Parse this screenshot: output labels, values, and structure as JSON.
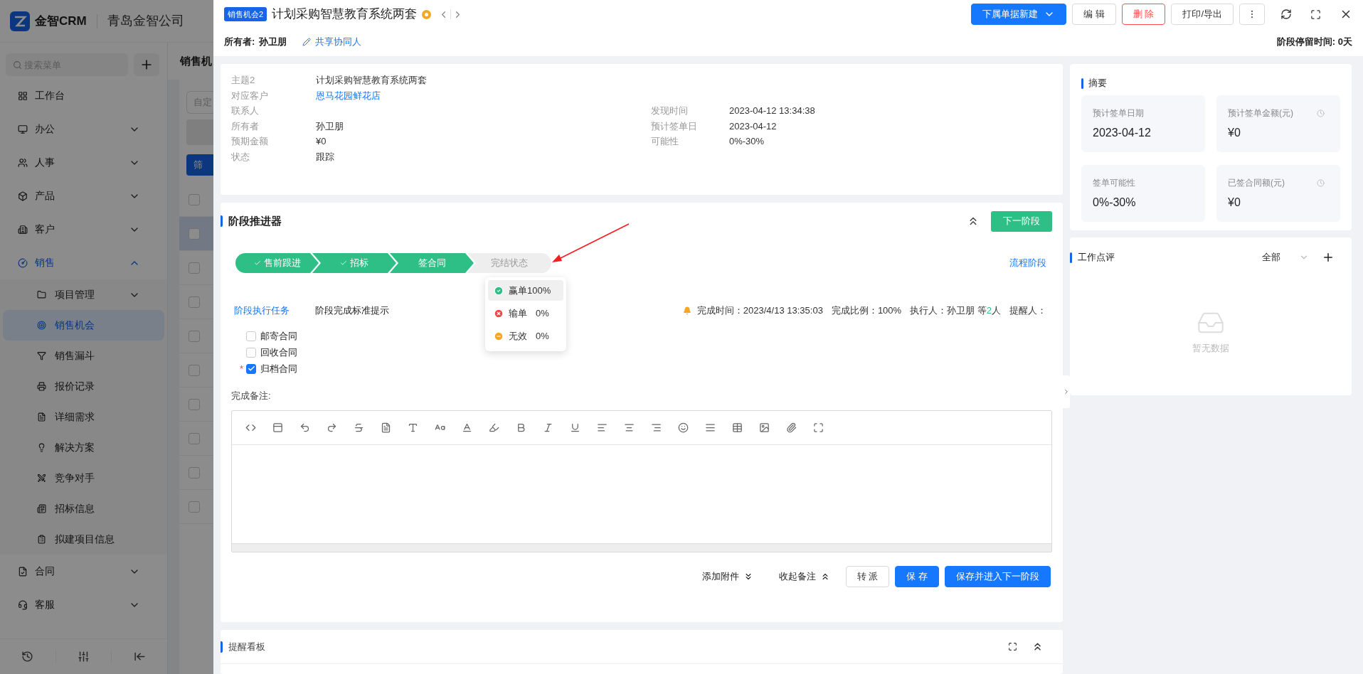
{
  "sidebar": {
    "brand": "金智CRM",
    "company": "青岛金智公司",
    "search": {
      "placeholder": "搜索菜单"
    },
    "items": [
      {
        "label": "工作台",
        "selected": false
      },
      {
        "label": "办公",
        "selected": false,
        "expanded": false
      },
      {
        "label": "人事",
        "selected": false,
        "expanded": false
      },
      {
        "label": "产品",
        "selected": false,
        "expanded": false
      },
      {
        "label": "客户",
        "selected": false,
        "expanded": false
      },
      {
        "label": "销售",
        "selected": true,
        "expanded": true,
        "children": [
          {
            "label": "项目管理",
            "selected": false,
            "expanded": false
          },
          {
            "label": "销售机会",
            "selected": true
          },
          {
            "label": "销售漏斗",
            "selected": false
          },
          {
            "label": "报价记录",
            "selected": false
          },
          {
            "label": "详细需求",
            "selected": false
          },
          {
            "label": "解决方案",
            "selected": false
          },
          {
            "label": "竞争对手",
            "selected": false
          },
          {
            "label": "招标信息",
            "selected": false
          },
          {
            "label": "拟建项目信息",
            "selected": false
          }
        ]
      },
      {
        "label": "合同",
        "selected": false,
        "expanded": false
      },
      {
        "label": "客服",
        "selected": false,
        "expanded": false
      }
    ]
  },
  "background_list": {
    "title": "销售机",
    "filter_placeholder": "自定",
    "filter_button": "筛",
    "rows": [
      {
        "checked": false,
        "selected": false
      },
      {
        "checked": false,
        "selected": true
      },
      {
        "checked": false,
        "selected": false
      },
      {
        "checked": false,
        "selected": false
      },
      {
        "checked": false,
        "selected": false
      },
      {
        "checked": false,
        "selected": false
      },
      {
        "checked": false,
        "selected": false
      },
      {
        "checked": false,
        "selected": false
      },
      {
        "checked": false,
        "selected": false
      },
      {
        "checked": false,
        "selected": false
      }
    ]
  },
  "header": {
    "tag": "销售机会2",
    "title": "计划采购智慧教育系统两套",
    "buttons": [
      {
        "label": "下属单据新建",
        "kind": "primary"
      },
      {
        "label": "编 辑",
        "kind": "default"
      },
      {
        "label": "删 除",
        "kind": "danger"
      },
      {
        "label": "打印/导出",
        "kind": "default"
      }
    ],
    "owner_label": "所有者:",
    "owner": "孙卫朋",
    "share_link": "共享协同人",
    "stay_time": "阶段停留时间: 0天"
  },
  "info": {
    "rows": [
      {
        "label": "主题2",
        "value": "计划采购智慧教育系统两套",
        "kind": "text"
      },
      {
        "label": "对应客户",
        "value": "恩马花园鲜花店",
        "kind": "link"
      },
      {
        "label": "联系人",
        "right": {
          "label": "发现时间",
          "value": "2023-04-12 13:34:38"
        }
      },
      {
        "label": "所有者",
        "value": "孙卫朋",
        "kind": "text",
        "right": {
          "label": "预计签单日",
          "value": "2023-04-12"
        }
      },
      {
        "label": "预期金额",
        "value": "¥0",
        "kind": "text",
        "right": {
          "label": "可能性",
          "value": "0%-30%"
        }
      },
      {
        "label": "状态",
        "value": "跟踪",
        "kind": "text"
      }
    ]
  },
  "stage": {
    "title": "阶段推进器",
    "next_button": "下一阶段",
    "stages": [
      {
        "label": "售前跟进",
        "done": true,
        "reached": true
      },
      {
        "label": "招标",
        "done": true,
        "reached": true
      },
      {
        "label": "签合同",
        "done": false,
        "reached": true
      },
      {
        "label": "完结状态",
        "done": false,
        "reached": false
      }
    ],
    "flow_link": "流程阶段",
    "outcomes": [
      {
        "kind": "win",
        "label": "赢单",
        "percent": "100%",
        "selected": true
      },
      {
        "kind": "lose",
        "label": "输单",
        "percent": "0%",
        "selected": false
      },
      {
        "kind": "void",
        "label": "无效",
        "percent": "0%",
        "selected": false
      }
    ],
    "tabs": [
      {
        "label": "阶段执行任务",
        "selected": true
      },
      {
        "label": "阶段完成标准提示",
        "selected": false
      }
    ],
    "completion_time": "完成时间：2023/4/13 13:35:03",
    "completion_ratio": "完成比例：100%",
    "executor": "执行人：孙卫朋 等",
    "executor_count": "2",
    "executor_suffix": "人",
    "reminder": "提醒人：",
    "tasks": [
      {
        "label": "邮寄合同",
        "checked": false
      },
      {
        "label": "回收合同",
        "checked": false
      },
      {
        "label": "归档合同",
        "checked": true,
        "prefix": "*"
      }
    ],
    "note_label": "完成备注:",
    "attach": "添加附件",
    "collapse_note": "收起备注",
    "actions": [
      {
        "label": "转 派",
        "kind": "default"
      },
      {
        "label": "保 存",
        "kind": "primary"
      },
      {
        "label": "保存并进入下一阶段",
        "kind": "primary"
      }
    ]
  },
  "reminder_board": {
    "title": "提醒看板"
  },
  "summary": {
    "title": "摘要",
    "tiles": [
      {
        "label": "预计签单日期",
        "value": "2023-04-12",
        "clock": false
      },
      {
        "label": "预计签单金额(元)",
        "value": "¥0",
        "clock": true
      },
      {
        "label": "签单可能性",
        "value": "0%-30%",
        "clock": false
      },
      {
        "label": "已签合同额(元)",
        "value": "¥0",
        "clock": true
      }
    ]
  },
  "review": {
    "title": "工作点评",
    "filter": "全部",
    "empty": "暂无数据"
  }
}
